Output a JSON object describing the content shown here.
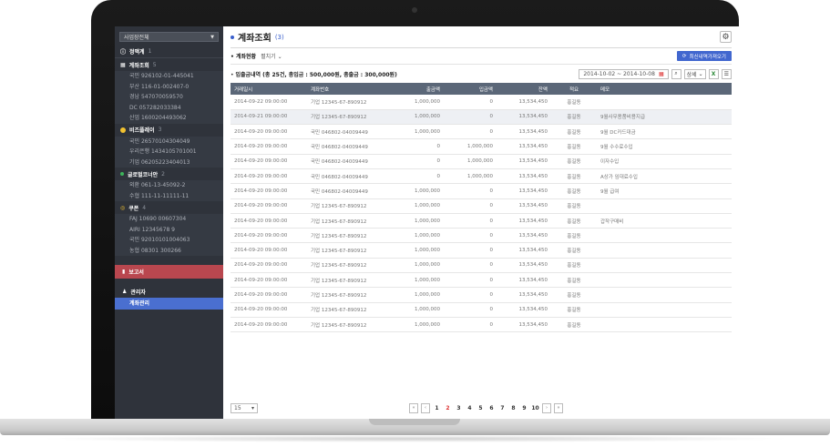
{
  "sidebar": {
    "company_select": "사업장전체",
    "sections": [
      {
        "title": "정맥계",
        "count": "1"
      },
      {
        "title": "계좌조회",
        "count": "5",
        "items": [
          "국민 926102-01-445041",
          "부산 116-01-002407-0",
          "경남 547070059570",
          "DC 057282033384",
          "산업 1600204493062"
        ]
      },
      {
        "title": "비즈플레이",
        "count": "3",
        "items": [
          "국민 26570104304049",
          "우리은행 1434105701001",
          "기업 06205223404013"
        ]
      },
      {
        "title": "글로벌코너안",
        "count": "2",
        "items": [
          "외환 061-13-45092-2",
          "수협 111-11-11111-11"
        ]
      },
      {
        "title": "쿠폰",
        "count": "4",
        "items": [
          "FAJ 10690 00607304",
          "AIRI 12345678 9",
          "국민 92010101004063",
          "농협 08301 300266"
        ]
      }
    ],
    "report_label": "보고서",
    "admin_label": "관리자",
    "active_item": "계좌관리"
  },
  "header": {
    "title": "계좌조회",
    "title_count": "(3)",
    "status_label": "계좌현황",
    "status_select": "펼치기",
    "refresh_label": "최신내역가져오기"
  },
  "summary": {
    "text": "입출금내역 (총 25건, 총입금 : 500,000원, 총출금 : 300,000원)",
    "date_range": "2014-10-02 ~ 2014-10-08",
    "detail_label": "상세"
  },
  "table": {
    "columns": [
      "거래일시",
      "계좌번호",
      "출금액",
      "입금액",
      "잔액",
      "적요",
      "메모"
    ],
    "rows": [
      [
        "2014-09-22 09:00:00",
        "기업 12345-67-890912",
        "1,000,000",
        "0",
        "13,534,450",
        "홍길동",
        ""
      ],
      [
        "2014-09-21 09:00:00",
        "기업 12345-67-890912",
        "1,000,000",
        "0",
        "13,534,450",
        "홍길동",
        "9월사무용품비용지급"
      ],
      [
        "2014-09-20 09:00:00",
        "국민 046802-04009449",
        "1,000,000",
        "0",
        "13,534,450",
        "홍길동",
        "9월 DC카드대금"
      ],
      [
        "2014-09-20 09:00:00",
        "국민 046802-04009449",
        "0",
        "1,000,000",
        "13,534,450",
        "홍길동",
        "9월 수수료수입"
      ],
      [
        "2014-09-20 09:00:00",
        "국민 046802-04009449",
        "0",
        "1,000,000",
        "13,534,450",
        "홍길동",
        "이자수입"
      ],
      [
        "2014-09-20 09:00:00",
        "국민 046802-04009449",
        "0",
        "1,000,000",
        "13,534,450",
        "홍길동",
        "A상가 임대료수입"
      ],
      [
        "2014-09-20 09:00:00",
        "국민 046802-04009449",
        "1,000,000",
        "0",
        "13,534,450",
        "홍길동",
        "9월 급여"
      ],
      [
        "2014-09-20 09:00:00",
        "기업 12345-67-890912",
        "1,000,000",
        "0",
        "13,534,450",
        "홍길동",
        ""
      ],
      [
        "2014-09-20 09:00:00",
        "기업 12345-67-890912",
        "1,000,000",
        "0",
        "13,534,450",
        "홍길동",
        "갑작구매비"
      ],
      [
        "2014-09-20 09:00:00",
        "기업 12345-67-890912",
        "1,000,000",
        "0",
        "13,534,450",
        "홍길동",
        ""
      ],
      [
        "2014-09-20 09:00:00",
        "기업 12345-67-890912",
        "1,000,000",
        "0",
        "13,534,450",
        "홍길동",
        ""
      ],
      [
        "2014-09-20 09:00:00",
        "기업 12345-67-890912",
        "1,000,000",
        "0",
        "13,534,450",
        "홍길동",
        ""
      ],
      [
        "2014-09-20 09:00:00",
        "기업 12345-67-890912",
        "1,000,000",
        "0",
        "13,534,450",
        "홍길동",
        ""
      ],
      [
        "2014-09-20 09:00:00",
        "기업 12345-67-890912",
        "1,000,000",
        "0",
        "13,534,450",
        "홍길동",
        ""
      ],
      [
        "2014-09-20 09:00:00",
        "기업 12345-67-890912",
        "1,000,000",
        "0",
        "13,534,450",
        "홍길동",
        ""
      ],
      [
        "2014-09-20 09:00:00",
        "기업 12345-67-890912",
        "1,000,000",
        "0",
        "13,534,450",
        "홍길동",
        ""
      ]
    ]
  },
  "pagination": {
    "page_size": "15",
    "pages": [
      "1",
      "2",
      "3",
      "4",
      "5",
      "6",
      "7",
      "8",
      "9",
      "10"
    ],
    "current": "2"
  },
  "colors": {
    "accent": "#4267cf",
    "sidebar_bg": "#2f333b",
    "report_red": "#b9474f",
    "current_page": "#d33333"
  }
}
